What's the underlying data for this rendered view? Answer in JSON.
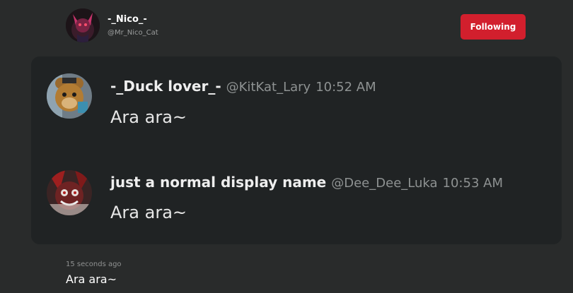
{
  "header": {
    "display_name": "-_Nico_-",
    "handle": "@Mr_Nico_Cat",
    "follow_button_label": "Following",
    "follow_button_color": "#d21f2d"
  },
  "card": {
    "messages": [
      {
        "display_name": "-_Duck lover_-",
        "handle": "@KitKat_Lary",
        "time": "10:52 AM",
        "text": "Ara ara~",
        "avatar_icon": "bear-character-avatar"
      },
      {
        "display_name": "just a normal display name",
        "handle": "@Dee_Dee_Luka",
        "time": "10:53 AM",
        "text": "Ara ara~",
        "avatar_icon": "red-character-avatar"
      }
    ]
  },
  "post": {
    "timestamp": "15 seconds ago",
    "text": "Ara ara~"
  },
  "colors": {
    "background": "#292b2b",
    "card": "#202324",
    "muted_text": "#8e9292"
  }
}
